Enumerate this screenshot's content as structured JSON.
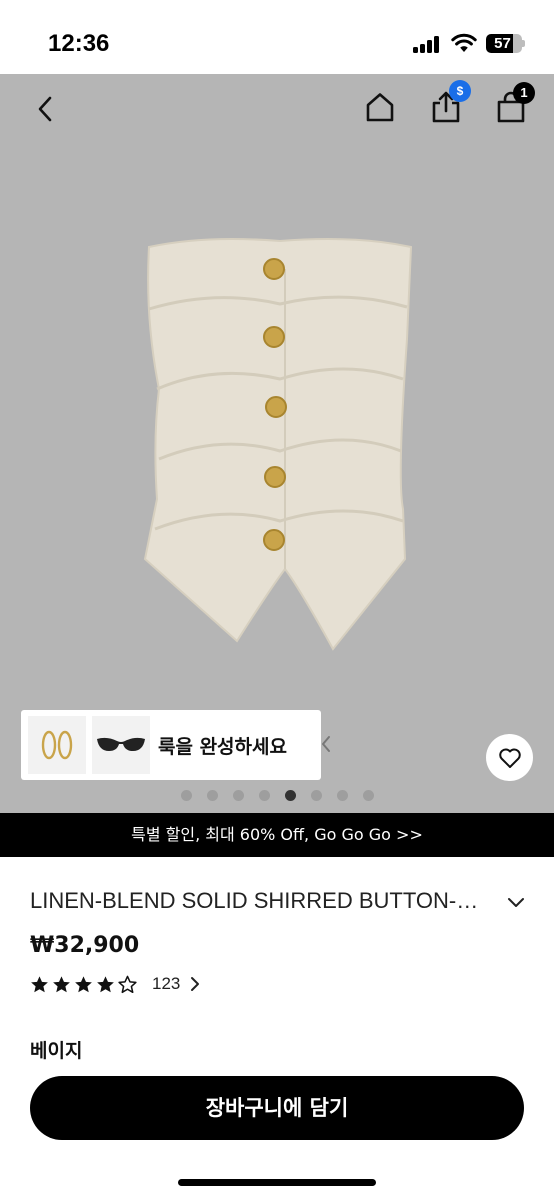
{
  "status_bar": {
    "time": "12:36",
    "battery": "57"
  },
  "header": {
    "back_icon": "chevron-left-icon",
    "home_icon": "home-icon",
    "share_icon": "share-icon",
    "share_badge": "$",
    "cart_icon": "shopping-bag-icon",
    "cart_count": "1"
  },
  "hero": {
    "background": "#b5b5b5",
    "garment_color": "#e6e0d3",
    "button_color": "#c9a44a",
    "complete_look": {
      "label": "룩을 완성하세요",
      "items": [
        "earrings-icon",
        "sunglasses-icon"
      ]
    },
    "wishlist_icon": "heart-icon",
    "carousel": {
      "total": 8,
      "active_index": 4
    }
  },
  "promo": {
    "text": "특별 할인, 최대 60% Off, Go Go Go >>"
  },
  "product": {
    "title": "LINEN-BLEND SOLID SHIRRED BUTTON-FRONT TUBE TOP",
    "price": "₩32,900",
    "rating": 4,
    "max_rating": 5,
    "review_count": "123",
    "color_name": "베이지"
  },
  "cta": {
    "label": "장바구니에 담기"
  }
}
